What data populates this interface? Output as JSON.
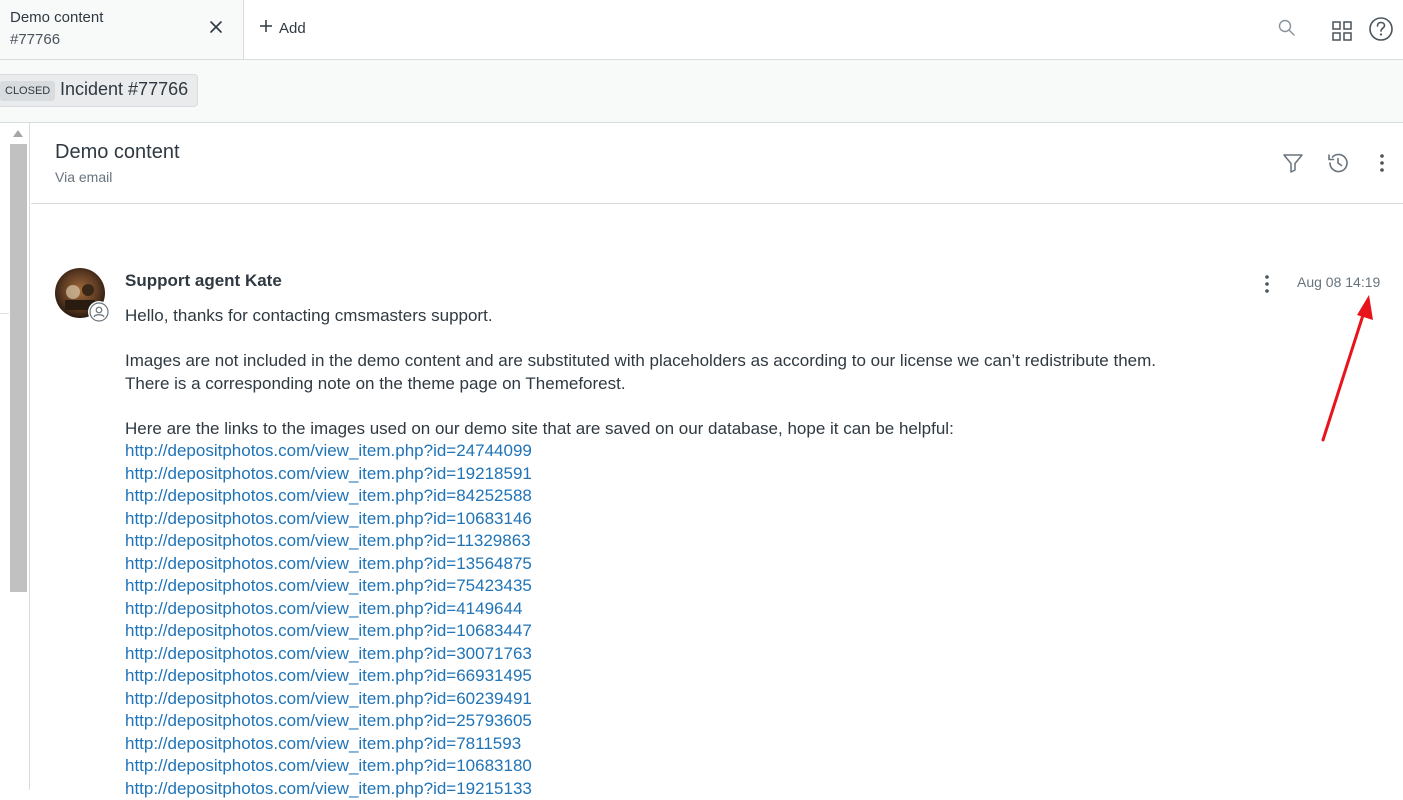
{
  "tab": {
    "title": "Demo content",
    "subtitle": "#77766"
  },
  "toolbar": {
    "add_label": "Add"
  },
  "incident": {
    "status": "CLOSED",
    "label": "Incident #77766"
  },
  "ticket": {
    "title": "Demo content",
    "via": "Via email"
  },
  "comment": {
    "author": "Support agent Kate",
    "timestamp": "Aug 08 14:19",
    "paragraphs": [
      "Hello, thanks for contacting cmsmasters support.",
      "Images are not included in the demo content and are substituted with placeholders as according to our license we can’t redistribute them.",
      "There is a corresponding note on the theme page on Themeforest.",
      "Here are the links to the images used on our demo site that are saved on our database, hope it can be helpful:"
    ],
    "links": [
      "http://depositphotos.com/view_item.php?id=24744099",
      "http://depositphotos.com/view_item.php?id=19218591",
      "http://depositphotos.com/view_item.php?id=84252588",
      "http://depositphotos.com/view_item.php?id=10683146",
      "http://depositphotos.com/view_item.php?id=11329863",
      "http://depositphotos.com/view_item.php?id=13564875",
      "http://depositphotos.com/view_item.php?id=75423435",
      "http://depositphotos.com/view_item.php?id=4149644",
      "http://depositphotos.com/view_item.php?id=10683447",
      "http://depositphotos.com/view_item.php?id=30071763",
      "http://depositphotos.com/view_item.php?id=66931495",
      "http://depositphotos.com/view_item.php?id=60239491",
      "http://depositphotos.com/view_item.php?id=25793605",
      "http://depositphotos.com/view_item.php?id=7811593",
      "http://depositphotos.com/view_item.php?id=10683180",
      "http://depositphotos.com/view_item.php?id=19215133"
    ]
  },
  "colors": {
    "link": "#1f73b7",
    "annotation_arrow": "#e8141b",
    "text": "#2f3941"
  },
  "icons": [
    "close-icon",
    "plus-icon",
    "search-icon",
    "apps-grid-icon",
    "help-icon",
    "filter-icon",
    "history-icon",
    "more-vertical-icon",
    "user-icon"
  ]
}
